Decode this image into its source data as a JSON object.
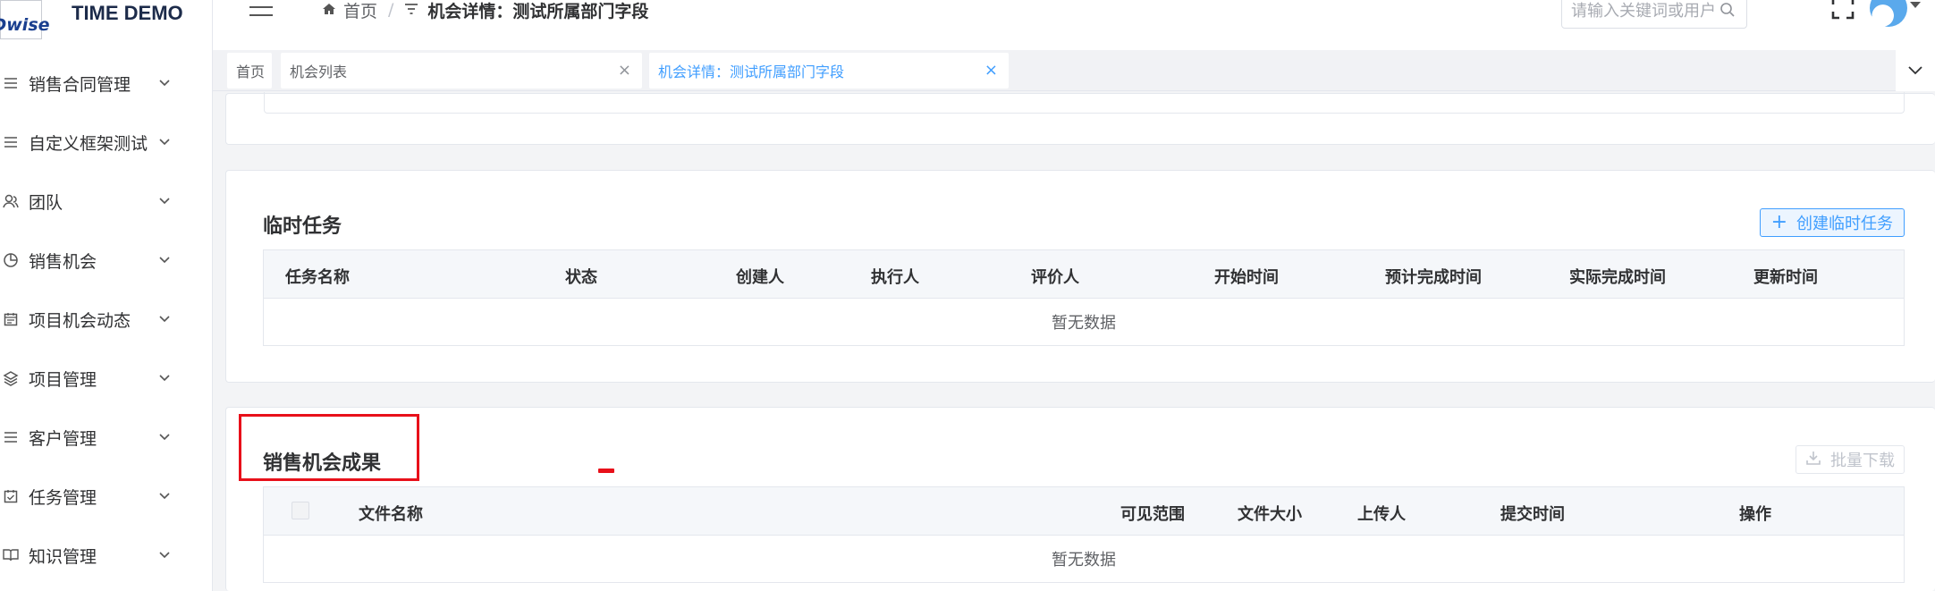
{
  "app": {
    "logo_text": "Dwise",
    "title": "TIME DEMO"
  },
  "sidebar": {
    "items": [
      {
        "label": "销售合同管理",
        "icon": "list-icon"
      },
      {
        "label": "自定义框架测试",
        "icon": "list-icon"
      },
      {
        "label": "团队",
        "icon": "team-icon"
      },
      {
        "label": "销售机会",
        "icon": "pie-chart-icon"
      },
      {
        "label": "项目机会动态",
        "icon": "calendar-icon"
      },
      {
        "label": "项目管理",
        "icon": "layers-icon"
      },
      {
        "label": "客户管理",
        "icon": "list-icon"
      },
      {
        "label": "任务管理",
        "icon": "checklist-icon"
      },
      {
        "label": "知识管理",
        "icon": "book-icon"
      }
    ]
  },
  "header": {
    "breadcrumb_home": "首页",
    "breadcrumb_current": "机会详情：测试所属部门字段",
    "search_placeholder": "请输入关键词或用户名"
  },
  "tags": [
    {
      "label": "首页",
      "active": false,
      "closable": false
    },
    {
      "label": "机会列表",
      "active": false,
      "closable": true
    },
    {
      "label": "机会详情：测试所属部门字段",
      "active": true,
      "closable": true
    }
  ],
  "tasks_section": {
    "title": "临时任务",
    "create_button": "创建临时任务",
    "columns": [
      "任务名称",
      "状态",
      "创建人",
      "执行人",
      "评价人",
      "开始时间",
      "预计完成时间",
      "实际完成时间",
      "更新时间"
    ],
    "empty_text": "暂无数据"
  },
  "results_section": {
    "title": "销售机会成果",
    "download_button": "批量下载",
    "columns": [
      "文件名称",
      "可见范围",
      "文件大小",
      "上传人",
      "提交时间",
      "操作"
    ],
    "empty_text": "暂无数据"
  },
  "colors": {
    "primary": "#409eff",
    "highlight": "#e8101a"
  }
}
